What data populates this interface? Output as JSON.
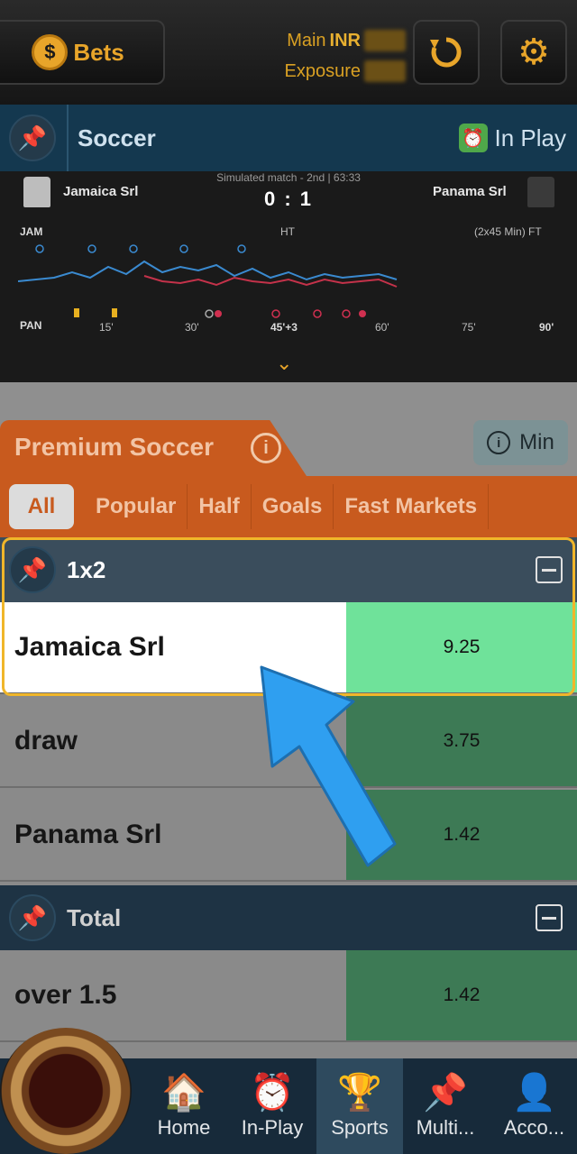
{
  "header": {
    "bets_label": "Bets",
    "bets_icon": "dollar-coin-icon",
    "main_label": "Main",
    "main_currency": "INR",
    "exposure_label": "Exposure",
    "refresh_icon": "refresh-icon",
    "settings_icon": "gear-icon"
  },
  "event": {
    "sport": "Soccer",
    "status": "In Play",
    "status_icon": "alarm-clock-icon"
  },
  "tracker": {
    "home_team": "Jamaica Srl",
    "away_team": "Panama Srl",
    "match_info": "Simulated match - 2nd | 63:33",
    "score": "0 : 1",
    "home_abbr": "JAM",
    "away_abbr": "PAN",
    "ht_label": "HT",
    "ft_label": "(2x45 Min) FT",
    "ticks": [
      "15'",
      "30'",
      "45'+3",
      "60'",
      "75'",
      "90'"
    ]
  },
  "premium": {
    "title": "Premium Soccer",
    "min_label": "Min",
    "filters": [
      "All",
      "Popular",
      "Half",
      "Goals",
      "Fast Markets"
    ],
    "active_filter": "All"
  },
  "markets": [
    {
      "title": "1x2",
      "selections": [
        {
          "name": "Jamaica Srl",
          "odds": "9.25"
        },
        {
          "name": "draw",
          "odds": "3.75"
        },
        {
          "name": "Panama Srl",
          "odds": "1.42"
        }
      ]
    },
    {
      "title": "Total",
      "selections": [
        {
          "name": "over 1.5",
          "odds": "1.42"
        }
      ]
    }
  ],
  "nav": {
    "items": [
      "Home",
      "In-Play",
      "Sports",
      "Multi...",
      "Acco..."
    ],
    "active": "Sports"
  },
  "colors": {
    "accent": "#e8a52a",
    "premium": "#c85a1e",
    "odds_green": "#3d7a55",
    "highlight_green": "#6fe29a",
    "pointer_arrow": "#2f9ff0"
  }
}
